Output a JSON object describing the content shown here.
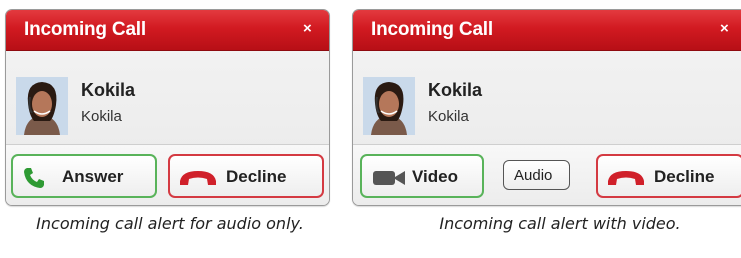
{
  "alerts": [
    {
      "title": "Incoming Call",
      "close_glyph": "×",
      "caller_name": "Kokila",
      "caller_sub": "Kokila",
      "buttons": {
        "answer": "Answer",
        "decline": "Decline"
      },
      "caption": "Incoming call alert for audio only."
    },
    {
      "title": "Incoming Call",
      "close_glyph": "×",
      "caller_name": "Kokila",
      "caller_sub": "Kokila",
      "buttons": {
        "video": "Video",
        "audio": "Audio",
        "decline": "Decline"
      },
      "caption": "Incoming call alert with video."
    }
  ],
  "colors": {
    "titlebar": "#d21a21",
    "answer_border": "#59b35a",
    "decline_border": "#d43a42",
    "answer_icon": "#2e9a33",
    "decline_icon": "#d0202a",
    "video_icon": "#555555"
  },
  "icons": {
    "close": "close-icon",
    "answer": "phone-icon",
    "decline": "hang-up-icon",
    "video": "video-camera-icon",
    "avatar": "avatar"
  }
}
